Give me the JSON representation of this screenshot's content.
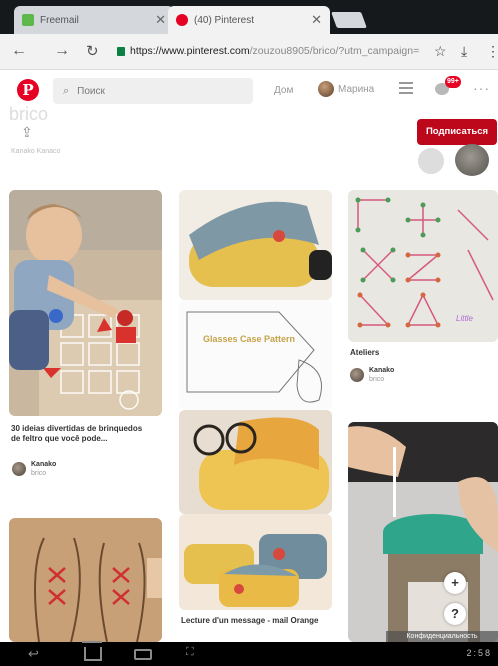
{
  "browser": {
    "tabs": [
      {
        "title": "Freemail",
        "favicon_color": "#5fb84a",
        "active": false
      },
      {
        "title": "(40) Pinterest",
        "favicon_color": "#e60023",
        "active": true
      }
    ],
    "url_host": "https://www.pinterest.com",
    "url_path": "/zouzou8905/brico/?utm_campaign=",
    "back_icon": "arrow-left-icon",
    "forward_icon": "arrow-right-icon",
    "reload_icon": "reload-icon"
  },
  "header": {
    "logo": "P",
    "search_placeholder": "Поиск",
    "home_label": "Дом",
    "user_name": "Марина",
    "notifications_badge": "99+",
    "more_label": "···"
  },
  "board": {
    "name": "brico",
    "meta": "Kanako Kanaco",
    "follow_label": "Подписаться"
  },
  "pins": [
    {
      "title": "30 ideias divertidas de brinquedos de feltro que você pode...",
      "user": "Kanako",
      "board": "brico"
    },
    {
      "title": "",
      "image_text": "Glasses Case Pattern",
      "user": "",
      "board": ""
    },
    {
      "title": "Ateliers",
      "user": "Kanako",
      "board": "brico",
      "image_caption": "Little"
    },
    {
      "title": "Lecture d'un message - mail Orange",
      "user": "",
      "board": ""
    }
  ],
  "floating": {
    "add_label": "+",
    "help_label": "?",
    "privacy_label": "Конфиденциальность"
  },
  "statusbar": {
    "time": "2:58"
  },
  "colors": {
    "brand": "#e60023",
    "follow": "#bd081c"
  }
}
